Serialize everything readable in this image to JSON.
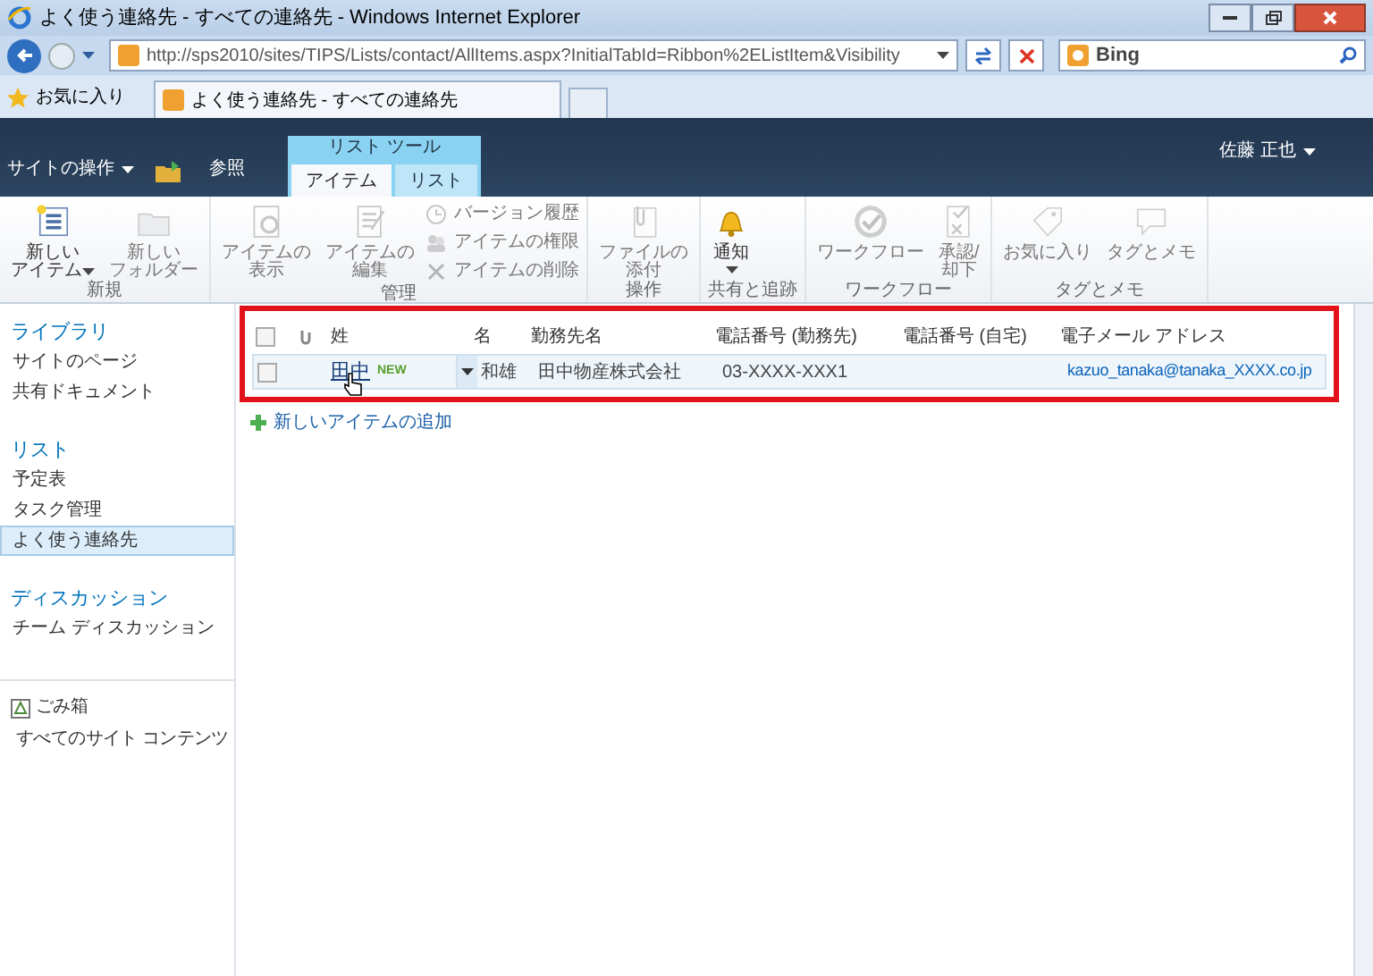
{
  "window": {
    "title": "よく使う連絡先 - すべての連絡先 - Windows Internet Explorer"
  },
  "browser": {
    "address": "http://sps2010/sites/TIPS/Lists/contact/AllItems.aspx?InitialTabId=Ribbon%2EListItem&Visibility",
    "search_placeholder": "Bing",
    "favorites": "お気に入り",
    "tab_title": "よく使う連絡先 - すべての連絡先"
  },
  "ribbon": {
    "site_actions": "サイトの操作",
    "browse": "参照",
    "contextual": "リスト ツール",
    "user": "佐藤 正也",
    "tabs": [
      {
        "label": "アイテム",
        "selected": true
      },
      {
        "label": "リスト",
        "selected": false
      }
    ],
    "groups": [
      {
        "label": "新規",
        "buttons": [
          {
            "kind": "large",
            "lines": [
              "新しい",
              "アイテム"
            ],
            "dropdown": true,
            "disabled": false
          },
          {
            "kind": "large",
            "lines": [
              "新しい",
              "フォルダー"
            ],
            "dropdown": false,
            "disabled": true
          }
        ]
      },
      {
        "label": "管理",
        "buttons": [
          {
            "kind": "large",
            "lines": [
              "アイテムの",
              "表示"
            ],
            "dropdown": false,
            "disabled": true
          },
          {
            "kind": "large",
            "lines": [
              "アイテムの",
              "編集"
            ],
            "dropdown": false,
            "disabled": true
          },
          {
            "kind": "small",
            "lines": [
              "バージョン履歴"
            ],
            "dropdown": false,
            "disabled": true
          },
          {
            "kind": "small",
            "lines": [
              "アイテムの権限"
            ],
            "dropdown": false,
            "disabled": true
          },
          {
            "kind": "small",
            "lines": [
              "アイテムの削除"
            ],
            "dropdown": false,
            "disabled": true
          }
        ]
      },
      {
        "label": "操作",
        "buttons": [
          {
            "kind": "large",
            "lines": [
              "ファイルの",
              "添付"
            ],
            "dropdown": false,
            "disabled": true
          }
        ]
      },
      {
        "label": "共有と追跡",
        "buttons": [
          {
            "kind": "large",
            "lines": [
              "通知"
            ],
            "dropdown": true,
            "disabled": false
          }
        ]
      },
      {
        "label": "ワークフロー",
        "buttons": [
          {
            "kind": "large",
            "lines": [
              "ワークフロー"
            ],
            "dropdown": false,
            "disabled": true
          },
          {
            "kind": "large",
            "lines": [
              "承認/",
              "却下"
            ],
            "dropdown": false,
            "disabled": true
          }
        ]
      },
      {
        "label": "タグとメモ",
        "buttons": [
          {
            "kind": "large",
            "lines": [
              "お気に入り"
            ],
            "dropdown": false,
            "disabled": true
          },
          {
            "kind": "large",
            "lines": [
              "タグとメモ"
            ],
            "dropdown": false,
            "disabled": true
          }
        ]
      }
    ]
  },
  "nav": {
    "sections": [
      {
        "heading": "ライブラリ",
        "items": [
          {
            "label": "サイトのページ",
            "selected": false
          },
          {
            "label": "共有ドキュメント",
            "selected": false
          }
        ]
      },
      {
        "heading": "リスト",
        "items": [
          {
            "label": "予定表",
            "selected": false
          },
          {
            "label": "タスク管理",
            "selected": false
          },
          {
            "label": "よく使う連絡先",
            "selected": true
          }
        ]
      },
      {
        "heading": "ディスカッション",
        "items": [
          {
            "label": "チーム ディスカッション",
            "selected": false
          }
        ]
      }
    ],
    "bottom": [
      {
        "label": "ごみ箱"
      },
      {
        "label": "すべてのサイト コンテンツ"
      }
    ]
  },
  "table": {
    "select_all_checked": false,
    "columns": [
      {
        "label": "姓"
      },
      {
        "label": "名"
      },
      {
        "label": "勤務先名"
      },
      {
        "label": "電話番号 (勤務先)"
      },
      {
        "label": "電話番号 (自宅)"
      },
      {
        "label": "電子メール アドレス"
      }
    ],
    "rows": [
      {
        "checked": false,
        "badge": "NEW",
        "cells": [
          "田中",
          "和雄",
          "田中物産株式会社",
          "03-XXXX-XXX1",
          "",
          "kazuo_tanaka@tanaka_XXXX.co.jp"
        ]
      }
    ],
    "add_link": "新しいアイテムの追加"
  }
}
